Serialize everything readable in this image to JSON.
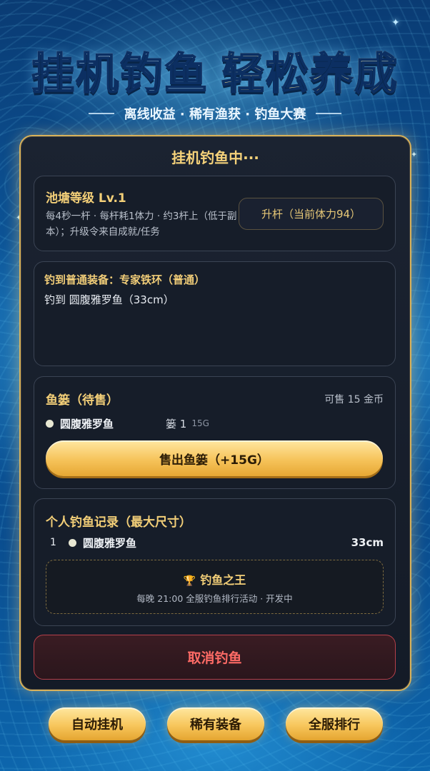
{
  "header": {
    "title_left": "挂机钓鱼",
    "title_right": "轻松养成",
    "subtitle": "离线收益 · 稀有渔获 · 钓鱼大赛"
  },
  "panel": {
    "status_title": "挂机钓鱼中···",
    "pond": {
      "title": "池塘等级 Lv.1",
      "description": "每4秒一杆 · 每杆耗1体力 · 约3杆上（低于副本）；升级令来自成就/任务",
      "upgrade_label": "升杆（当前体力94）"
    },
    "catch_log": {
      "line1": "钓到普通装备：专家铁环（普通）",
      "line2": "钓到 圆腹雅罗鱼（33cm）"
    },
    "basket": {
      "title": "鱼篓（待售）",
      "sell_value": "可售 15 金币",
      "items": [
        {
          "name": "圆腹雅罗鱼",
          "count": "篓 1",
          "price": "15G"
        }
      ],
      "sell_label": "售出鱼篓（+15G）"
    },
    "records": {
      "title": "个人钓鱼记录（最大尺寸）",
      "rows": [
        {
          "rank": "1",
          "name": "圆腹雅罗鱼",
          "size": "33cm"
        }
      ],
      "king": {
        "trophy_icon": "🏆",
        "title": "钓鱼之王",
        "subtitle": "每晚 21:00 全服钓鱼排行活动 · 开发中"
      }
    },
    "cancel_label": "取消钓鱼"
  },
  "bottom_nav": {
    "auto": "自动挂机",
    "rare": "稀有装备",
    "rank": "全服排行"
  },
  "colors": {
    "gold": "#f3cf78",
    "danger": "#ff6b66",
    "panel_bg": "#161d29"
  }
}
